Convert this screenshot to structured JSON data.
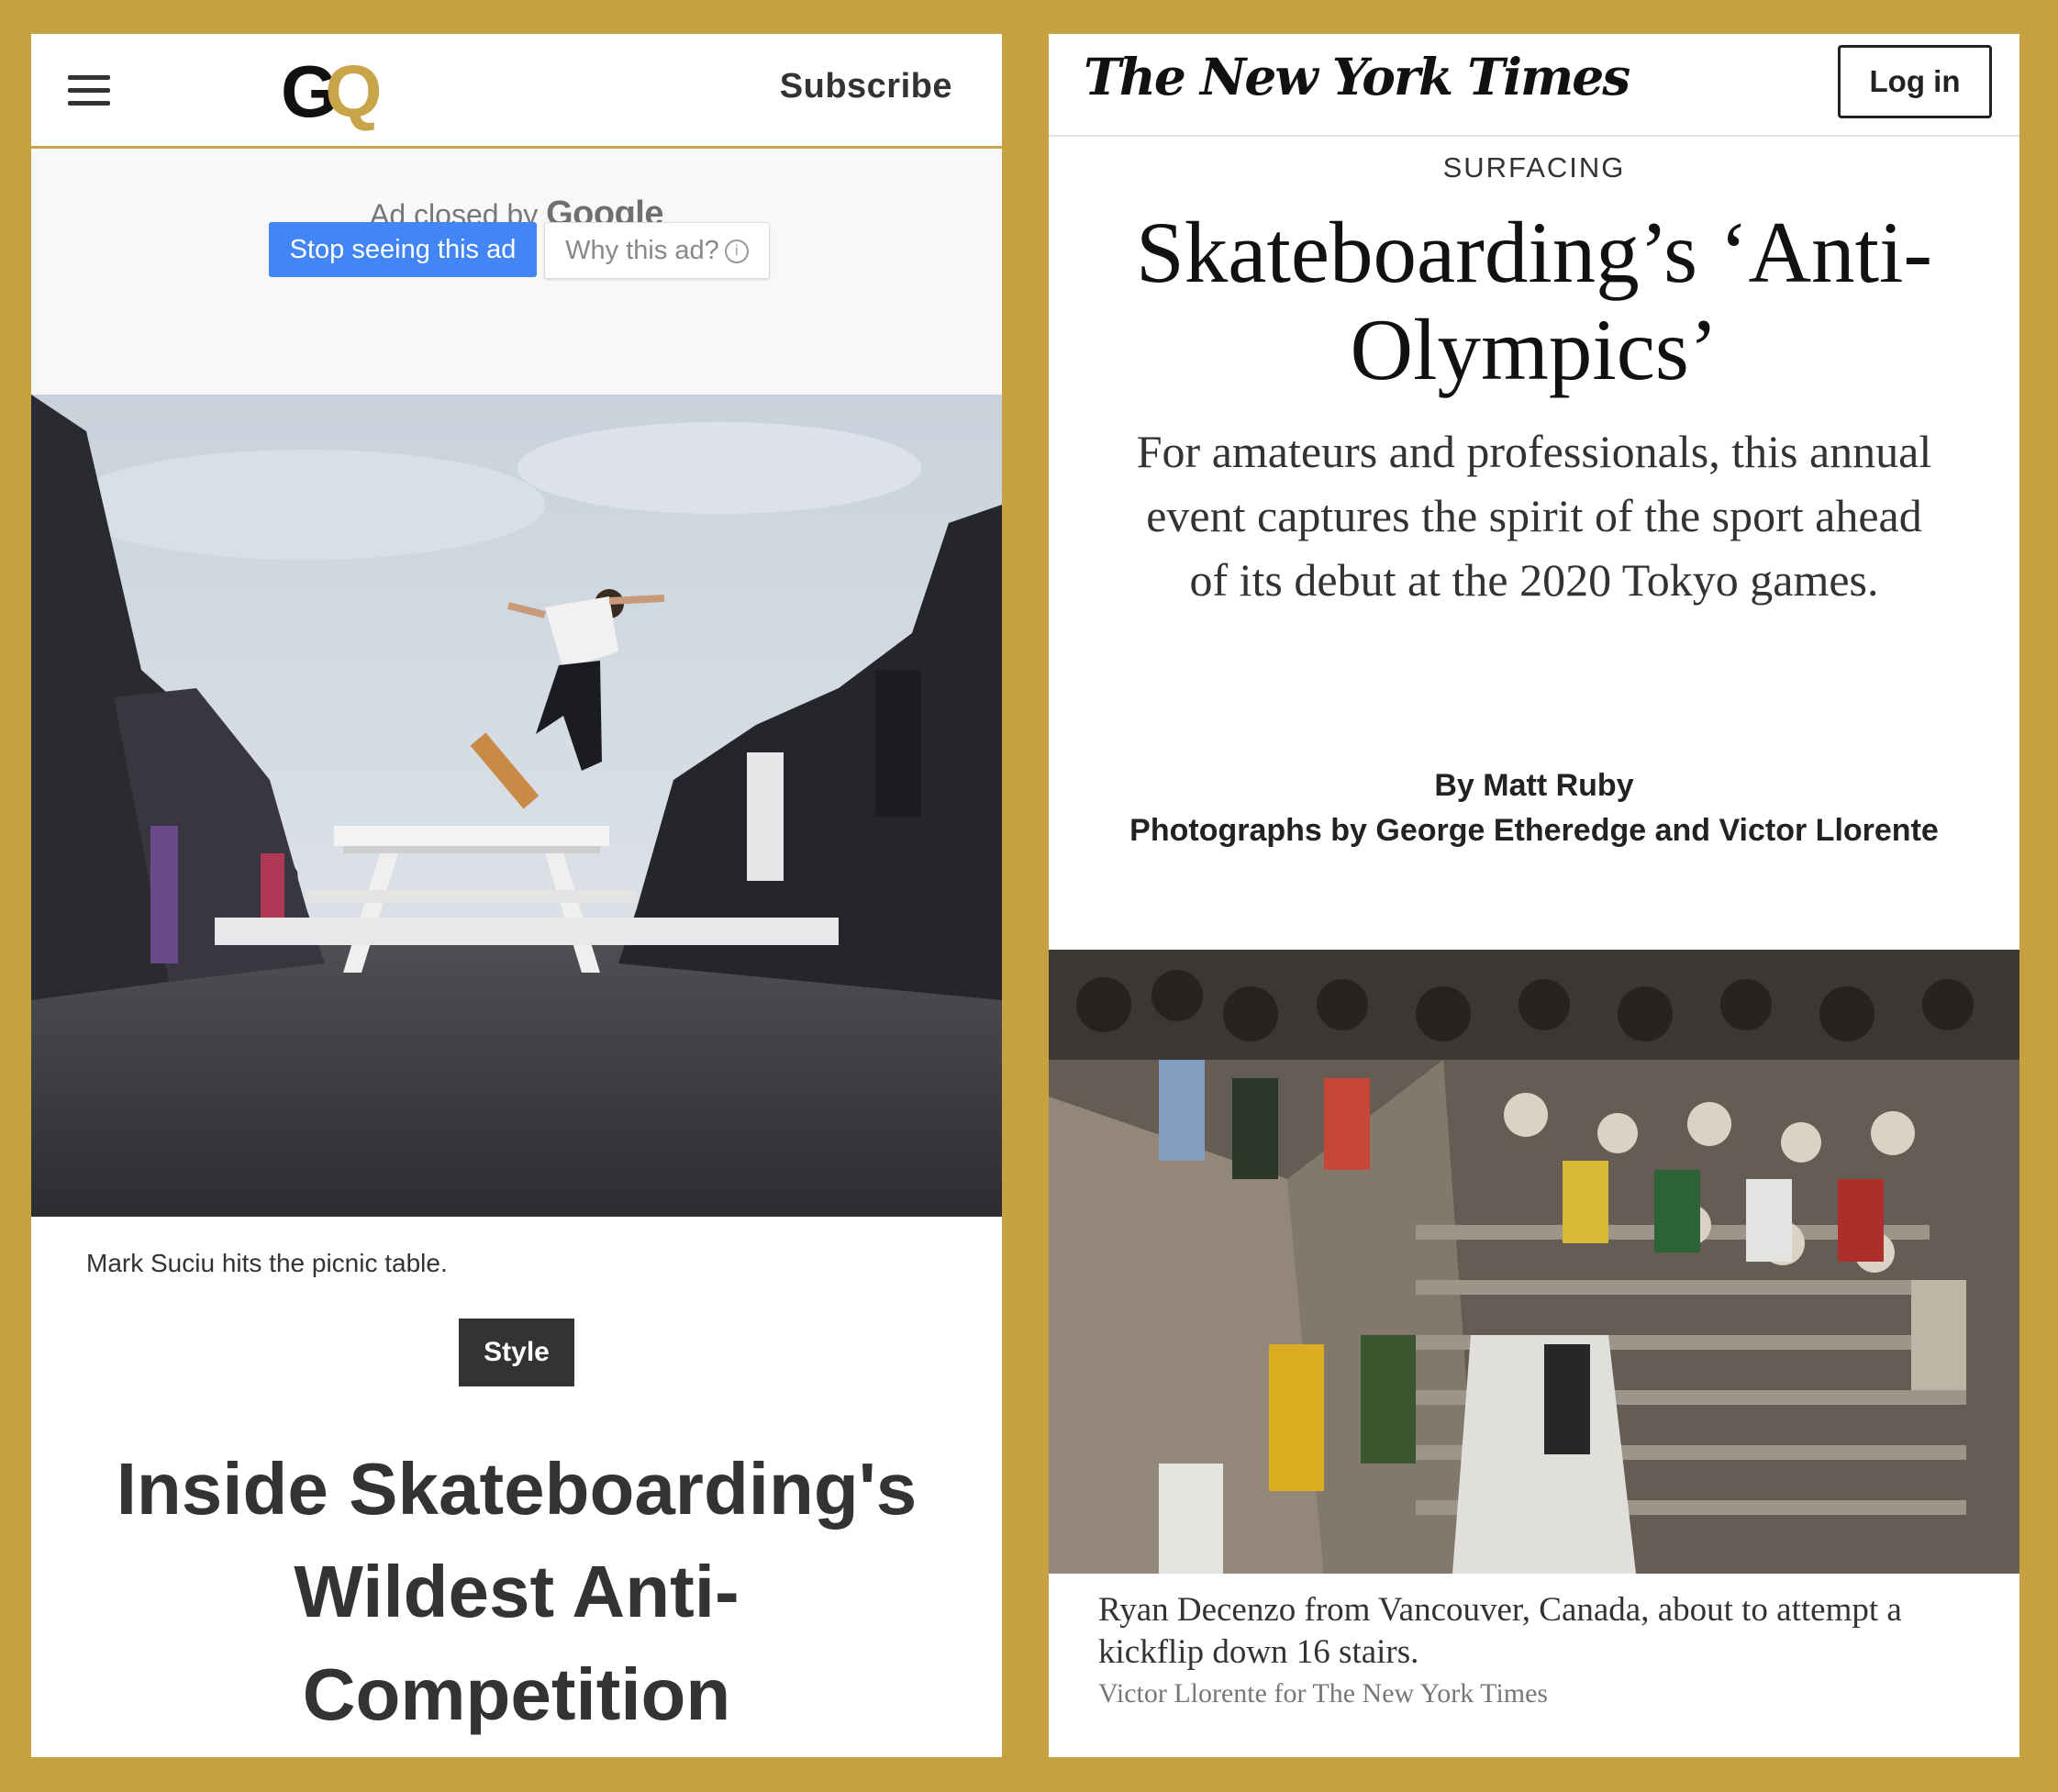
{
  "gq": {
    "logo_g": "G",
    "logo_q": "Q",
    "subscribe_label": "Subscribe",
    "ad": {
      "closed_by": "Ad closed by",
      "google": "Google",
      "stop_label": "Stop seeing this ad",
      "why_label": "Why this ad?"
    },
    "photo_caption": "Mark Suciu hits the picnic table.",
    "section_tag": "Style",
    "headline": "Inside Skateboarding's Wildest Anti-Competition"
  },
  "nyt": {
    "logo": "The New York Times",
    "login_label": "Log in",
    "kicker": "SURFACING",
    "headline": "Skateboarding’s ‘Anti-Olympics’",
    "summary": "For amateurs and professionals, this annual event captures the spirit of the sport ahead of its debut at the 2020 Tokyo games.",
    "byline": "By Matt Ruby",
    "photographers": "Photographs by George Etheredge and Victor Llorente",
    "photo_caption": "Ryan Decenzo from Vancouver, Canada, about to attempt a kickflip down 16 stairs.",
    "photo_credit": "Victor Llorente for The New York Times"
  },
  "colors": {
    "background": "#c5a23f",
    "gq_gold": "#c9a54a",
    "google_blue": "#4285f4"
  },
  "icons": [
    "hamburger-menu-icon",
    "info-icon"
  ]
}
